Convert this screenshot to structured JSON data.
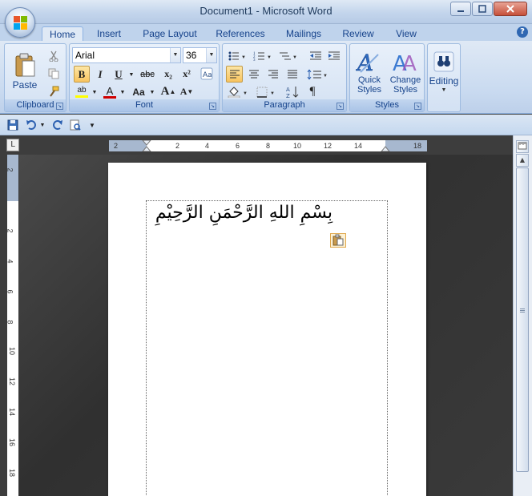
{
  "window": {
    "title": "Document1 - Microsoft Word"
  },
  "tabs": [
    {
      "label": "Home",
      "active": true
    },
    {
      "label": "Insert"
    },
    {
      "label": "Page Layout"
    },
    {
      "label": "References"
    },
    {
      "label": "Mailings"
    },
    {
      "label": "Review"
    },
    {
      "label": "View"
    }
  ],
  "ribbon": {
    "clipboard": {
      "label": "Clipboard",
      "paste_label": "Paste"
    },
    "font": {
      "label": "Font",
      "font_name": "Arial",
      "font_size": "36",
      "bold": "B",
      "italic": "I",
      "underline": "U",
      "strikethrough": "abc",
      "subscript": "x₂",
      "superscript": "x²",
      "grow_font": "A",
      "shrink_font": "A",
      "change_case": "Aa",
      "highlight": "ab",
      "font_color": "A"
    },
    "paragraph": {
      "label": "Paragraph"
    },
    "styles": {
      "label": "Styles",
      "quick_styles": "Quick Styles",
      "change_styles": "Change Styles"
    },
    "editing": {
      "label": "Editing"
    }
  },
  "ruler": {
    "h_ticks": [
      "2",
      "2",
      "4",
      "6",
      "8",
      "10",
      "12",
      "14",
      "18"
    ],
    "v_ticks": [
      "2",
      "2",
      "4",
      "6",
      "8",
      "10",
      "12",
      "14",
      "16",
      "18"
    ]
  },
  "document": {
    "text": "بِسْمِ اللهِ الرَّحْمَنِ الرَّحِيْمِ"
  },
  "colors": {
    "ribbon": "#dfe9f5",
    "accent": "#15428b",
    "pressed": "#f8c35e",
    "font_color_bar": "#d00000"
  }
}
